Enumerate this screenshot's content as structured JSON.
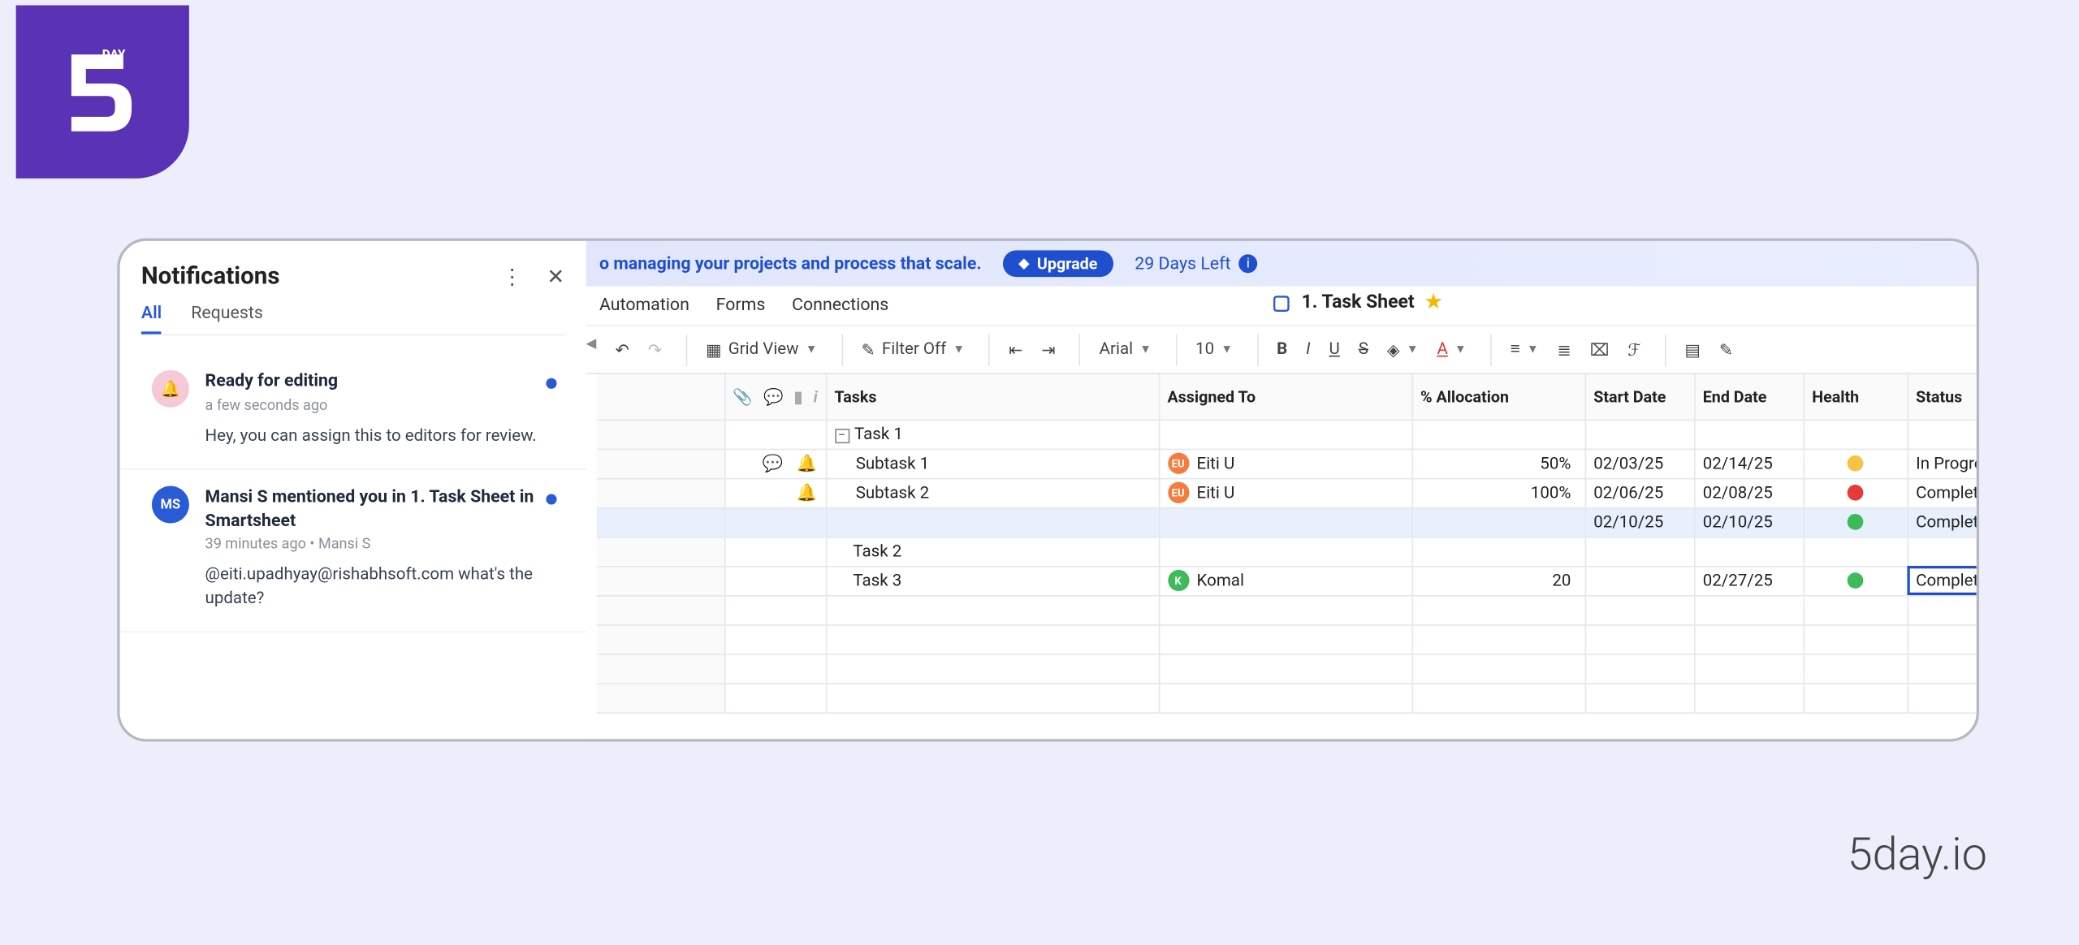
{
  "brand": {
    "day_text": "DAY",
    "footer": "5day.io"
  },
  "notifications": {
    "title": "Notifications",
    "tabs": {
      "all": "All",
      "requests": "Requests"
    },
    "items": [
      {
        "avatar_kind": "bell",
        "avatar_text": "",
        "heading": "Ready for editing",
        "meta": "a few seconds ago",
        "text": "Hey, you can assign this to editors for review."
      },
      {
        "avatar_kind": "ms",
        "avatar_text": "MS",
        "heading": "Mansi S mentioned you in 1. Task Sheet in Smartsheet",
        "meta": "39 minutes ago  •  Mansi S",
        "text": "@eiti.upadhyay@rishabhsoft.com what's the update?"
      }
    ]
  },
  "banner": {
    "text_fragment": "o managing your projects and process that scale.",
    "upgrade": "Upgrade",
    "days_left": "29 Days Left"
  },
  "menus": {
    "automation": "Automation",
    "forms": "Forms",
    "connections": "Connections"
  },
  "sheet": {
    "title": "1. Task Sheet"
  },
  "toolbar": {
    "grid_view": "Grid View",
    "filter_off": "Filter Off",
    "font": "Arial",
    "size": "10"
  },
  "columns": {
    "tasks": "Tasks",
    "assigned": "Assigned To",
    "alloc": "% Allocation",
    "start": "Start Date",
    "end": "End Date",
    "health": "Health",
    "status": "Status"
  },
  "rows": [
    {
      "kind": "group",
      "task": "Task 1",
      "assigned": "",
      "alloc": "",
      "start": "",
      "end": "",
      "health": "",
      "status": "",
      "icons": ""
    },
    {
      "kind": "sub",
      "task": "Subtask 1",
      "assigned": "Eiti U",
      "avatar": "eu",
      "alloc": "50%",
      "start": "02/03/25",
      "end": "02/14/25",
      "health": "yellow",
      "status": "In Progress",
      "icons": "chat-bell"
    },
    {
      "kind": "sub",
      "task": "Subtask 2",
      "assigned": "Eiti U",
      "avatar": "eu",
      "alloc": "100%",
      "start": "02/06/25",
      "end": "02/08/25",
      "health": "red",
      "status": "Complete",
      "icons": "bell"
    },
    {
      "kind": "highlight",
      "task": "",
      "assigned": "",
      "alloc": "",
      "start": "02/10/25",
      "end": "02/10/25",
      "health": "green",
      "status": "Complete",
      "icons": ""
    },
    {
      "kind": "plain",
      "task": "Task 2",
      "assigned": "",
      "alloc": "",
      "start": "",
      "end": "",
      "health": "",
      "status": "",
      "icons": ""
    },
    {
      "kind": "plain-select",
      "task": "Task 3",
      "assigned": "Komal",
      "avatar": "k",
      "alloc": "20",
      "start": "",
      "end": "02/27/25",
      "health": "green",
      "status": "Complete",
      "icons": ""
    },
    {
      "kind": "empty"
    },
    {
      "kind": "empty"
    },
    {
      "kind": "empty"
    },
    {
      "kind": "empty"
    }
  ]
}
